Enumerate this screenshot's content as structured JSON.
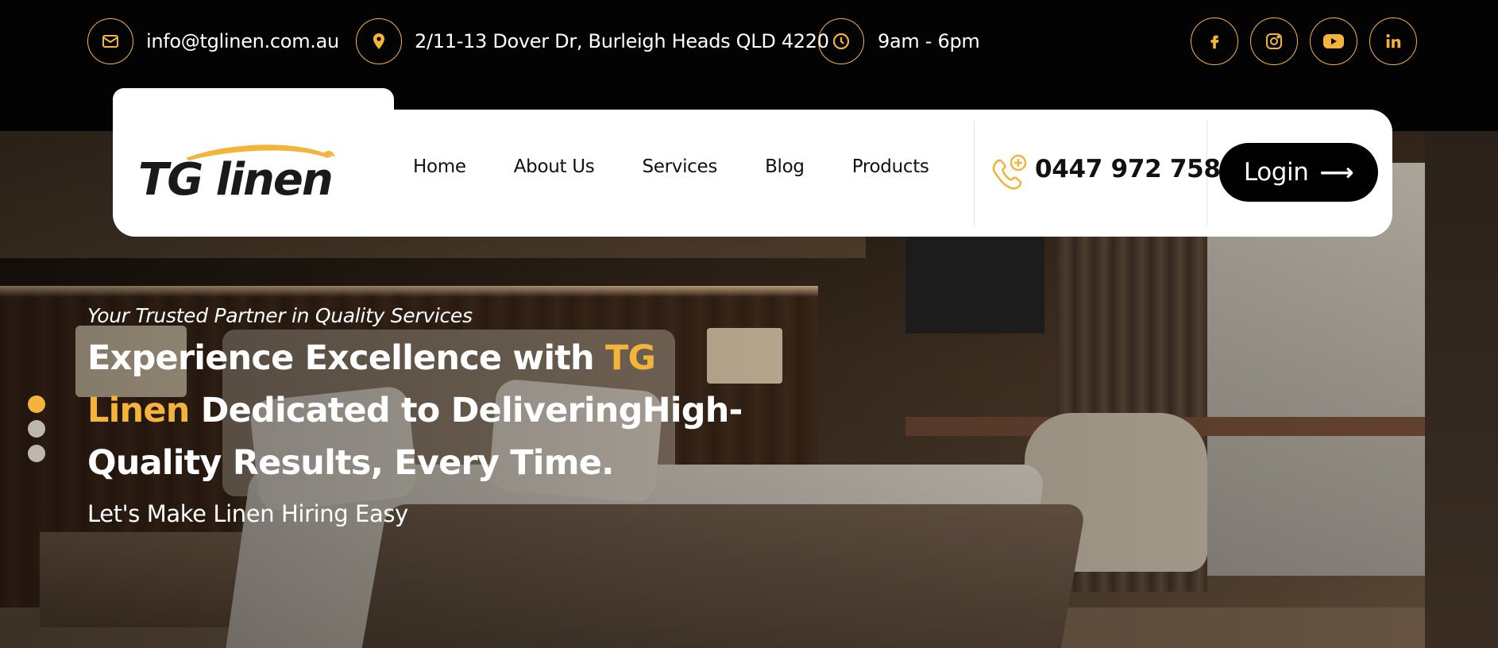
{
  "topbar": {
    "email": "info@tglinen.com.au",
    "address": "2/11-13 Dover Dr, Burleigh Heads QLD 4220",
    "hours": "9am - 6pm",
    "social": [
      "facebook-icon",
      "instagram-icon",
      "youtube-icon",
      "linkedin-icon"
    ]
  },
  "brand": {
    "logo_text": "TG linen",
    "accent": "#f4b43c"
  },
  "nav": {
    "items": [
      "Home",
      "About Us",
      "Services",
      "Blog",
      "Products"
    ],
    "phone": "0447 972 758",
    "login_label": "Login"
  },
  "hero": {
    "kicker": "Your Trusted Partner in Quality Services",
    "title_part1": "Experience Excellence with ",
    "title_accent": "TG Linen",
    "title_part2": " Dedicated to DeliveringHigh-Quality Results, Every Time.",
    "subtitle": "Let's Make Linen Hiring Easy",
    "slides": 3,
    "active_slide": 1
  }
}
